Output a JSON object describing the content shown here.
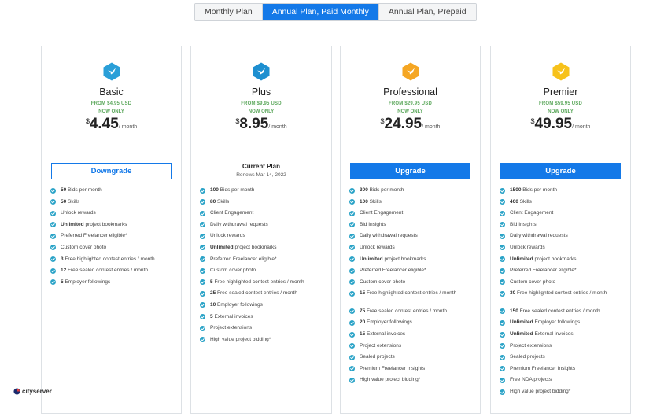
{
  "tabs": [
    {
      "label": "Monthly Plan",
      "active": false
    },
    {
      "label": "Annual Plan, Paid Monthly",
      "active": true
    },
    {
      "label": "Annual Plan, Prepaid",
      "active": false
    }
  ],
  "plans": [
    {
      "name": "Basic",
      "from": "FROM $4.95 USD",
      "now_only": "NOW ONLY",
      "currency": "$",
      "price": "4.45",
      "per": "/ month",
      "icon_color": "#2a9fd8",
      "button": "Downgrade",
      "features": [
        {
          "bold": "50",
          "text": "Bids per month"
        },
        {
          "bold": "50",
          "text": "Skills"
        },
        {
          "bold": "",
          "text": "Unlock rewards"
        },
        {
          "bold": "Unlimited",
          "text": "project bookmarks"
        },
        {
          "bold": "",
          "text": "Preferred Freelancer eligible*"
        },
        {
          "bold": "",
          "text": "Custom cover photo"
        },
        {
          "bold": "3",
          "text": "Free highlighted contest entries / month"
        },
        {
          "bold": "12",
          "text": "Free sealed contest entries / month"
        },
        {
          "bold": "5",
          "text": "Employer followings"
        }
      ]
    },
    {
      "name": "Plus",
      "from": "FROM $9.95 USD",
      "now_only": "NOW ONLY",
      "currency": "$",
      "price": "8.95",
      "per": "/ month",
      "icon_color": "#1d8fd0",
      "current_label": "Current Plan",
      "renews": "Renews Mar 14, 2022",
      "features": [
        {
          "bold": "100",
          "text": "Bids per month"
        },
        {
          "bold": "80",
          "text": "Skills"
        },
        {
          "bold": "",
          "text": "Client Engagement"
        },
        {
          "bold": "",
          "text": "Daily withdrawal requests"
        },
        {
          "bold": "",
          "text": "Unlock rewards"
        },
        {
          "bold": "Unlimited",
          "text": "project bookmarks"
        },
        {
          "bold": "",
          "text": "Preferred Freelancer eligible*"
        },
        {
          "bold": "",
          "text": "Custom cover photo"
        },
        {
          "bold": "5",
          "text": "Free highlighted contest entries / month"
        },
        {
          "bold": "25",
          "text": "Free sealed contest entries / month"
        },
        {
          "bold": "10",
          "text": "Employer followings"
        },
        {
          "bold": "5",
          "text": "External invoices"
        },
        {
          "bold": "",
          "text": "Project extensions"
        },
        {
          "bold": "",
          "text": "High value project bidding*"
        }
      ]
    },
    {
      "name": "Professional",
      "from": "FROM $29.95 USD",
      "now_only": "NOW ONLY",
      "currency": "$",
      "price": "24.95",
      "per": "/ month",
      "icon_color": "#f5a623",
      "button": "Upgrade",
      "features": [
        {
          "bold": "300",
          "text": "Bids per month"
        },
        {
          "bold": "100",
          "text": "Skills"
        },
        {
          "bold": "",
          "text": "Client Engagement"
        },
        {
          "bold": "",
          "text": "Bid Insights"
        },
        {
          "bold": "",
          "text": "Daily withdrawal requests"
        },
        {
          "bold": "",
          "text": "Unlock rewards"
        },
        {
          "bold": "Unlimited",
          "text": "project bookmarks"
        },
        {
          "bold": "",
          "text": "Preferred Freelancer eligible*"
        },
        {
          "bold": "",
          "text": "Custom cover photo"
        },
        {
          "bold": "15",
          "text": "Free highlighted contest entries / month",
          "wrap": true
        },
        {
          "bold": "75",
          "text": "Free sealed contest entries / month"
        },
        {
          "bold": "20",
          "text": "Employer followings"
        },
        {
          "bold": "15",
          "text": "External invoices"
        },
        {
          "bold": "",
          "text": "Project extensions"
        },
        {
          "bold": "",
          "text": "Sealed projects"
        },
        {
          "bold": "",
          "text": "Premium Freelancer Insights"
        },
        {
          "bold": "",
          "text": "High value project bidding*"
        }
      ]
    },
    {
      "name": "Premier",
      "from": "FROM $59.95 USD",
      "now_only": "NOW ONLY",
      "currency": "$",
      "price": "49.95",
      "per": "/ month",
      "icon_color": "#f7c21b",
      "button": "Upgrade",
      "features": [
        {
          "bold": "1500",
          "text": "Bids per month"
        },
        {
          "bold": "400",
          "text": "Skills"
        },
        {
          "bold": "",
          "text": "Client Engagement"
        },
        {
          "bold": "",
          "text": "Bid Insights"
        },
        {
          "bold": "",
          "text": "Daily withdrawal requests"
        },
        {
          "bold": "",
          "text": "Unlock rewards"
        },
        {
          "bold": "Unlimited",
          "text": "project bookmarks"
        },
        {
          "bold": "",
          "text": "Preferred Freelancer eligible*"
        },
        {
          "bold": "",
          "text": "Custom cover photo"
        },
        {
          "bold": "30",
          "text": "Free highlighted contest entries / month",
          "wrap": true
        },
        {
          "bold": "150",
          "text": "Free sealed contest entries / month"
        },
        {
          "bold": "Unlimited",
          "text": "Employer followings"
        },
        {
          "bold": "Unlimited",
          "text": "External invoices"
        },
        {
          "bold": "",
          "text": "Project extensions"
        },
        {
          "bold": "",
          "text": "Sealed projects"
        },
        {
          "bold": "",
          "text": "Premium Freelancer Insights"
        },
        {
          "bold": "",
          "text": "Free NDA projects"
        },
        {
          "bold": "",
          "text": "High value project bidding*"
        }
      ]
    }
  ],
  "watermark": {
    "text": "cityserver"
  },
  "colors": {
    "accent": "#1479e8",
    "price_green": "#5da85d",
    "check": "#2aa3c7"
  }
}
